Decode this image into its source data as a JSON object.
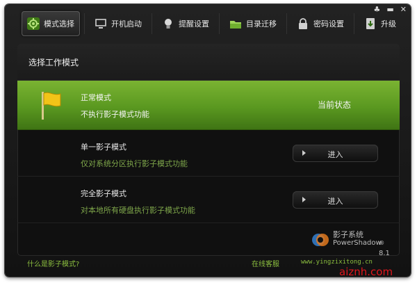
{
  "window_controls": {
    "menu": "♣",
    "minimize": "▬",
    "close": "✕"
  },
  "toolbar": {
    "tabs": [
      {
        "label": "模式选择",
        "icon": "gear-icon",
        "active": true
      },
      {
        "label": "开机启动",
        "icon": "monitor-icon"
      },
      {
        "label": "提醒设置",
        "icon": "bulb-icon"
      },
      {
        "label": "目录迁移",
        "icon": "folder-icon"
      },
      {
        "label": "密码设置",
        "icon": "lock-icon"
      },
      {
        "label": "升级",
        "icon": "upgrade-icon"
      }
    ]
  },
  "panel": {
    "header": "选择工作模式",
    "modes": [
      {
        "title": "正常模式",
        "desc": "不执行影子模式功能",
        "status": "当前状态",
        "icon": "flag-icon",
        "active": true
      },
      {
        "title": "单一影子模式",
        "desc": "仅对系统分区执行影子模式功能",
        "button": "进入"
      },
      {
        "title": "完全影子模式",
        "desc": "对本地所有硬盘执行影子模式功能",
        "button": "进入"
      }
    ]
  },
  "logo": {
    "name": "影子系统",
    "en": "PowerShadow",
    "reg": "®",
    "version": "8.1"
  },
  "footer": {
    "help_link": "什么是影子模式?",
    "support_link": "在线客服",
    "url": "www.yingzixitong.cn"
  },
  "watermark": "aiznh.com",
  "colors": {
    "accent_green": "#5a9820",
    "link_green": "#8cbf3f",
    "watermark_red": "#e0161c"
  }
}
